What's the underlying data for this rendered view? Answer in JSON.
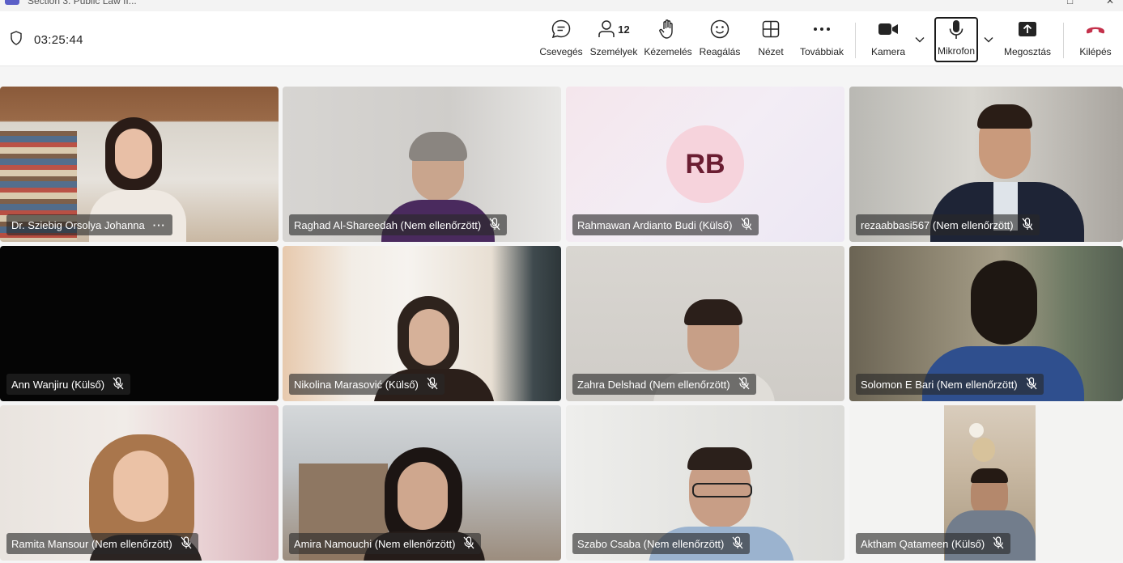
{
  "window": {
    "title": "Section 3: Public Law II..."
  },
  "toolbar": {
    "timer": "03:25:44",
    "chat_label": "Csevegés",
    "people_label": "Személyek",
    "people_count": "12",
    "raise_label": "Kézemelés",
    "react_label": "Reagálás",
    "view_label": "Nézet",
    "more_label": "Továbbiak",
    "camera_label": "Kamera",
    "mic_label": "Mikrofon",
    "share_label": "Megosztás",
    "leave_label": "Kilépés"
  },
  "participants": [
    {
      "name": "Dr. Sziebig Orsolya Johanna",
      "muted": false,
      "video": true
    },
    {
      "name": "Raghad Al-Shareedah (Nem ellenőrzött)",
      "muted": true,
      "video": true
    },
    {
      "name": "Rahmawan Ardianto Budi (Külső)",
      "muted": true,
      "video": false,
      "initials": "RB"
    },
    {
      "name": "rezaabbasi567 (Nem ellenőrzött)",
      "muted": true,
      "video": true
    },
    {
      "name": "Ann Wanjiru (Külső)",
      "muted": true,
      "video": false
    },
    {
      "name": "Nikolina Marasović (Külső)",
      "muted": true,
      "video": true
    },
    {
      "name": "Zahra Delshad (Nem ellenőrzött)",
      "muted": true,
      "video": true
    },
    {
      "name": "Solomon E Bari (Nem ellenőrzött)",
      "muted": true,
      "video": true
    },
    {
      "name": "Ramita Mansour (Nem ellenőrzött)",
      "muted": true,
      "video": true
    },
    {
      "name": "Amira Namouchi (Nem ellenőrzött)",
      "muted": true,
      "video": true
    },
    {
      "name": "Szabo Csaba (Nem ellenőrzött)",
      "muted": true,
      "video": true
    },
    {
      "name": "Aktham Qatameen (Külső)",
      "muted": true,
      "video": true
    }
  ],
  "colors": {
    "accent": "#5b5fc7",
    "leave": "#c4314b",
    "avatar_bg": "#f6d3dc",
    "avatar_fg": "#6b1d32"
  }
}
